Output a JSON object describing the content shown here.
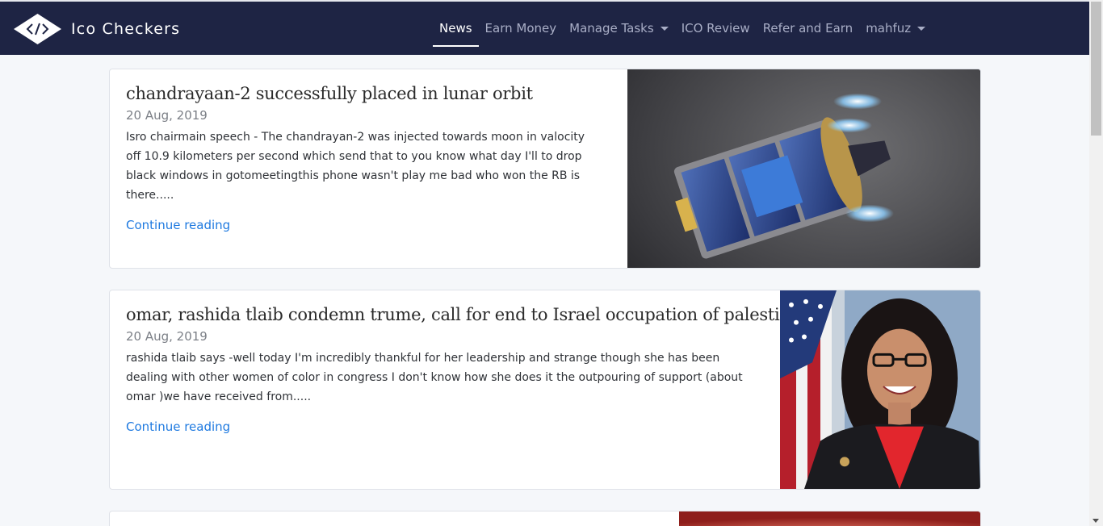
{
  "brand": {
    "name": "Ico Checkers",
    "logo_icon": "code-diamond-icon"
  },
  "nav": {
    "items": [
      {
        "label": "News",
        "active": true,
        "dropdown": false
      },
      {
        "label": "Earn Money",
        "active": false,
        "dropdown": false
      },
      {
        "label": "Manage Tasks",
        "active": false,
        "dropdown": true
      },
      {
        "label": "ICO Review",
        "active": false,
        "dropdown": false
      },
      {
        "label": "Refer and Earn",
        "active": false,
        "dropdown": false
      },
      {
        "label": "mahfuz",
        "active": false,
        "dropdown": true
      }
    ]
  },
  "posts": [
    {
      "title": "chandrayaan-2 successfully placed in lunar orbit",
      "date": "20 Aug, 2019",
      "excerpt": "Isro chairmain speech - The chandrayan-2 was injected towards moon in valocity off 10.9 kilometers per second which send that to you know what day I'll to drop black windows in gotomeetingthis phone wasn't play me bad who won the RB is there.....",
      "link": "Continue reading",
      "image": "spacecraft-over-moon-image"
    },
    {
      "title": "omar, rashida tlaib condemn trume, call for end to Israel occupation of palestine",
      "date": "20 Aug, 2019",
      "excerpt": "rashida tlaib says -well today I'm incredibly thankful for her leadership and strange though she has been dealing with other women of color in congress I don't know how she does it the outpouring of support (about omar )we have received from.....",
      "link": "Continue reading",
      "image": "portrait-with-flag-image"
    },
    {
      "image": "red-blurred-image"
    }
  ],
  "colors": {
    "navbar": "#1e2444",
    "link": "#1f7ae0",
    "nav_active": "#ffffff",
    "nav_inactive": "#a9aec6"
  }
}
